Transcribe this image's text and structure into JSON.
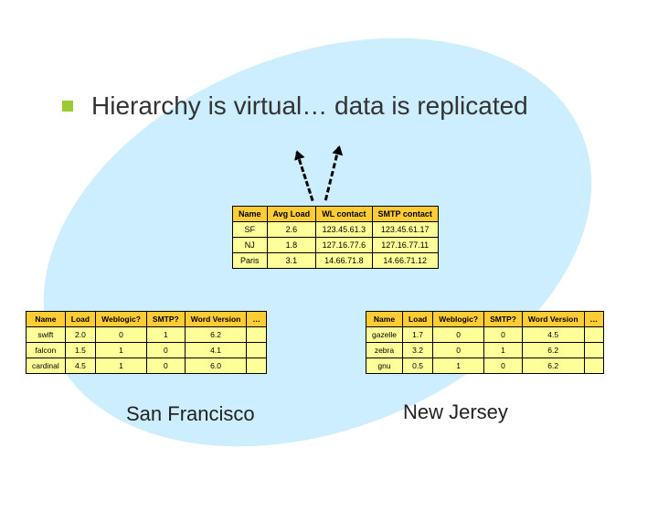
{
  "title": "Hierarchy is virtual… data is replicated",
  "summary": {
    "headers": [
      "Name",
      "Avg Load",
      "WL contact",
      "SMTP contact"
    ],
    "rows": [
      [
        "SF",
        "2.6",
        "123.45.61.3",
        "123.45.61.17"
      ],
      [
        "NJ",
        "1.8",
        "127.16.77.6",
        "127.16.77.11"
      ],
      [
        "Paris",
        "3.1",
        "14.66.71.8",
        "14.66.71.12"
      ]
    ]
  },
  "hosts_headers": [
    "Name",
    "Load",
    "Weblogic?",
    "SMTP?",
    "Word Version",
    "…"
  ],
  "sf": {
    "caption": "San Francisco",
    "rows": [
      [
        "swift",
        "2.0",
        "0",
        "1",
        "6.2",
        ""
      ],
      [
        "falcon",
        "1.5",
        "1",
        "0",
        "4.1",
        ""
      ],
      [
        "cardinal",
        "4.5",
        "1",
        "0",
        "6.0",
        ""
      ]
    ]
  },
  "nj": {
    "caption": "New Jersey",
    "rows": [
      [
        "gazelle",
        "1.7",
        "0",
        "0",
        "4.5",
        ""
      ],
      [
        "zebra",
        "3.2",
        "0",
        "1",
        "6.2",
        ""
      ],
      [
        "gnu",
        "0.5",
        "1",
        "0",
        "6.2",
        ""
      ]
    ]
  }
}
